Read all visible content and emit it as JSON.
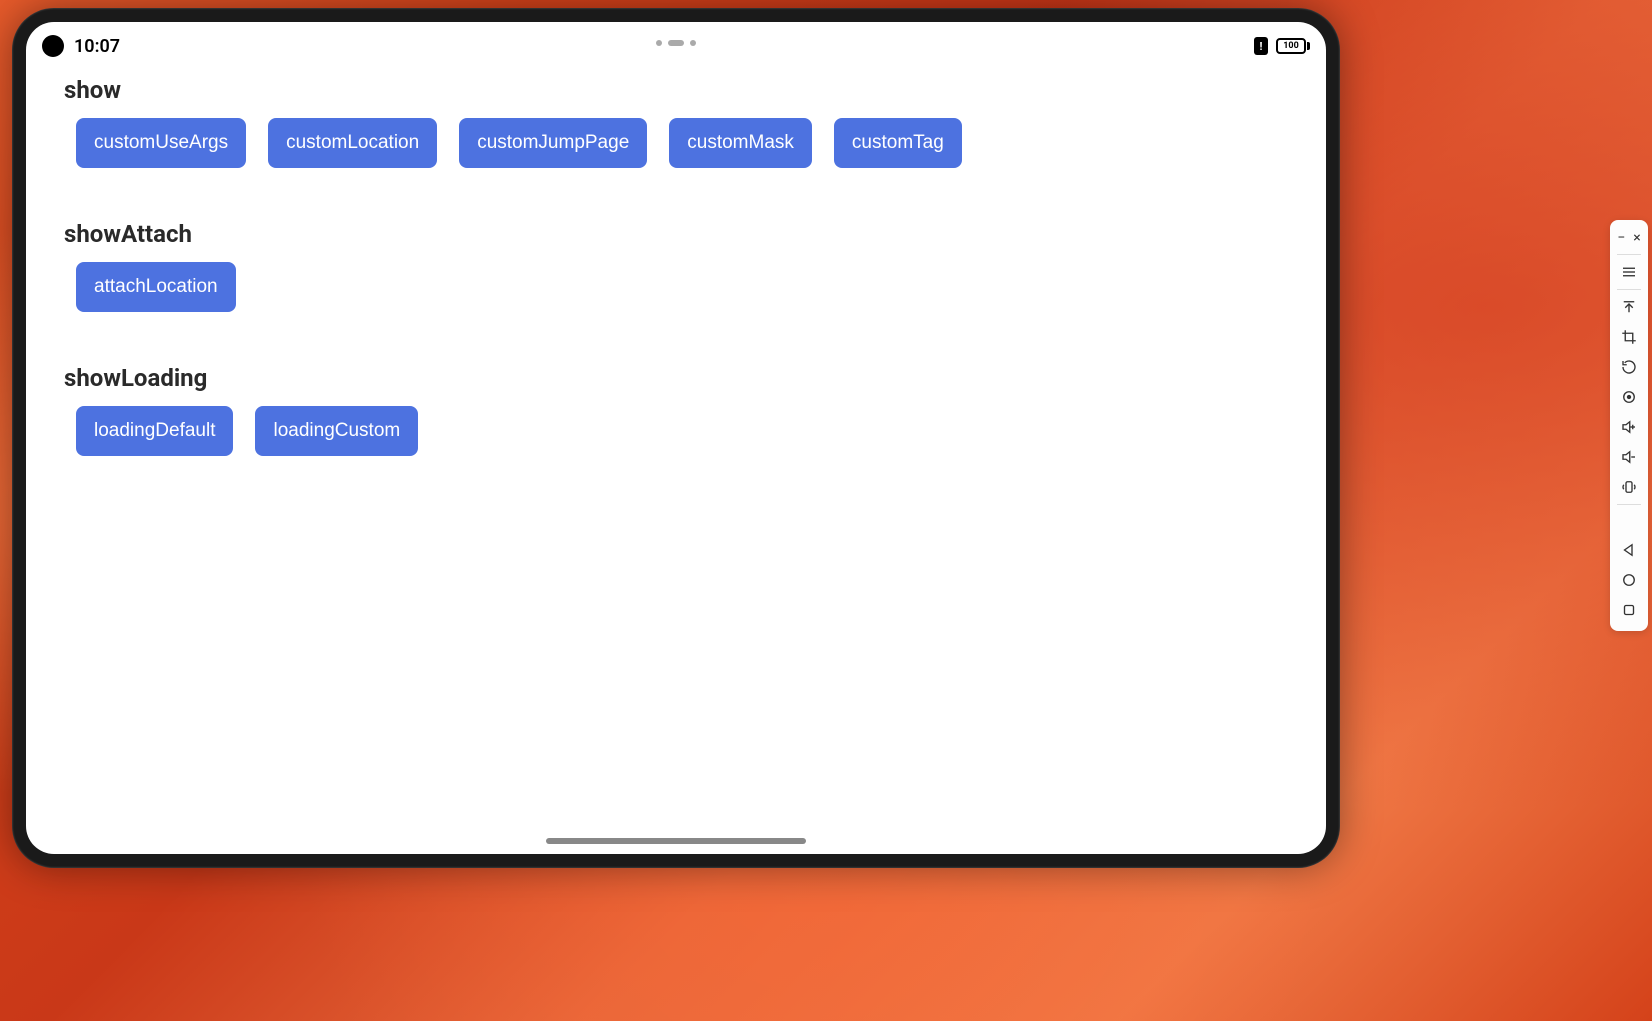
{
  "statusBar": {
    "time": "10:07",
    "batteryText": "100",
    "warnGlyph": "!"
  },
  "sections": [
    {
      "title": "show",
      "buttons": [
        "customUseArgs",
        "customLocation",
        "customJumpPage",
        "customMask",
        "customTag"
      ]
    },
    {
      "title": "showAttach",
      "buttons": [
        "attachLocation"
      ]
    },
    {
      "title": "showLoading",
      "buttons": [
        "loadingDefault",
        "loadingCustom"
      ]
    }
  ],
  "sidePanel": {
    "minimizeSymbol": "−",
    "closeSymbol": "×"
  }
}
